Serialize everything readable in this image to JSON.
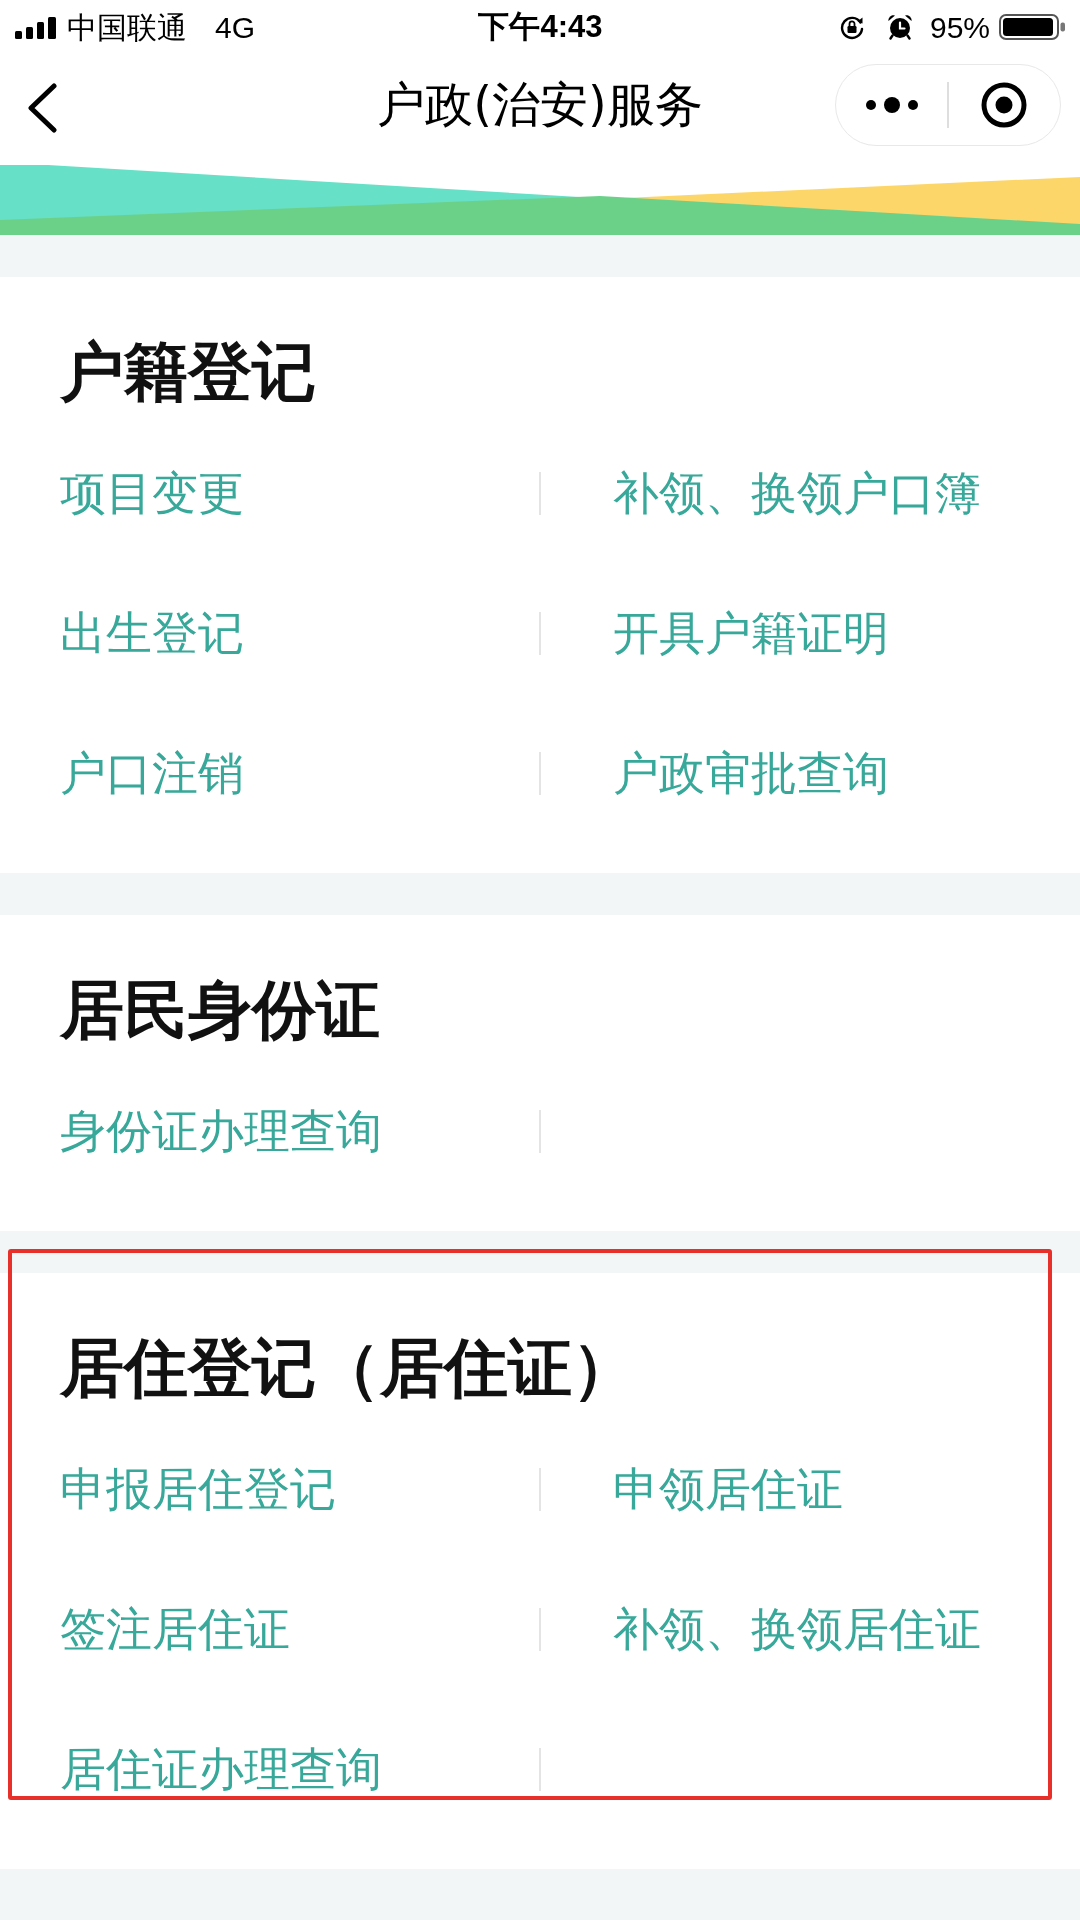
{
  "status_bar": {
    "carrier": "中国联通",
    "network": "4G",
    "time": "下午4:43",
    "battery": "95%"
  },
  "nav_bar": {
    "title": "户政(治安)服务"
  },
  "sections": [
    {
      "title": "户籍登记",
      "highlighted": false,
      "items": [
        "项目变更",
        "补领、换领户口簿",
        "出生登记",
        "开具户籍证明",
        "户口注销",
        "户政审批查询"
      ]
    },
    {
      "title": "居民身份证",
      "highlighted": false,
      "items": [
        "身份证办理查询"
      ]
    },
    {
      "title": "居住登记（居住证）",
      "highlighted": true,
      "items": [
        "申报居住登记",
        "申领居住证",
        "签注居住证",
        "补领、换领居住证",
        "居住证办理查询"
      ]
    }
  ]
}
